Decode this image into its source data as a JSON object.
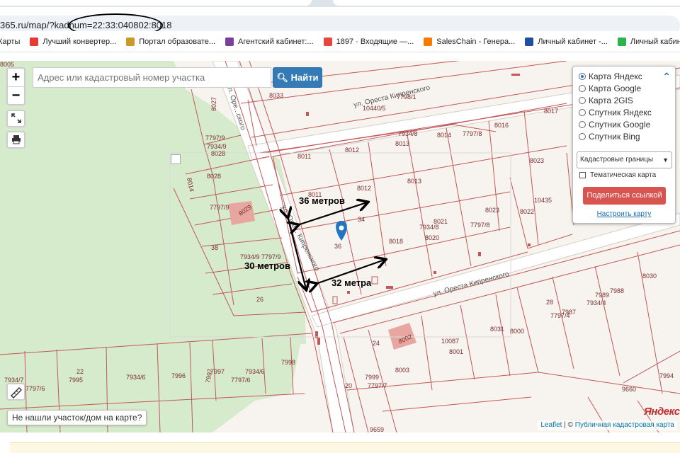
{
  "browser": {
    "url": "365.ru/map/?kadnum=22:33:040802:8018",
    "bookmarks": [
      {
        "label": "Карты",
        "icon": "maps-icon",
        "color": "#34a853"
      },
      {
        "label": "Лучший конвертер...",
        "icon": "converter-icon",
        "color": "#e53935"
      },
      {
        "label": "Портал образовате...",
        "icon": "coat-of-arms-icon",
        "color": "#c79a2a"
      },
      {
        "label": "Агентский кабинет:...",
        "icon": "agent-cabinet-icon",
        "color": "#7b3fa0"
      },
      {
        "label": "1897 · Входящие —...",
        "icon": "mail-icon",
        "color": "#e8453c"
      },
      {
        "label": "SalesChain - Генера...",
        "icon": "saleschain-icon",
        "color": "#f57c00"
      },
      {
        "label": "Личный кабинет -...",
        "icon": "cabinet-icon",
        "color": "#1e4fa3"
      },
      {
        "label": "Личный кабинет -...",
        "icon": "cabinet2-icon",
        "color": "#2bb24c"
      }
    ]
  },
  "map": {
    "search_placeholder": "Адрес или кадастровый номер участка",
    "search_button": "Найти",
    "zoom_in": "+",
    "zoom_out": "−",
    "layers": {
      "options": [
        {
          "label": "Карта Яндекс",
          "selected": true
        },
        {
          "label": "Карта Google",
          "selected": false
        },
        {
          "label": "Карта 2GIS",
          "selected": false
        },
        {
          "label": "Спутник Яндекс",
          "selected": false
        },
        {
          "label": "Спутник Google",
          "selected": false
        },
        {
          "label": "Спутник Bing",
          "selected": false
        }
      ],
      "select_value": "Кадастровые границы",
      "thematic_label": "Тематическая карта",
      "share_button": "Поделиться ссылкой",
      "setup_link": "Настроить карту"
    },
    "not_found_button": "Не нашли участок/дом на карте?",
    "attribution_leaflet": "Leaflet",
    "attribution_pkk": "Публичная кадастровая карта",
    "yandex_logo": "Яндекс",
    "streets": [
      "ул. Ореста Кипренского",
      "ул. Ореста Кипренского",
      "ул. Оре... Кипренского",
      "ул. Оре...ского"
    ],
    "annotations": [
      "36 метров",
      "30 метров",
      "32 метра"
    ],
    "parcel_labels": [
      "8033",
      "8027",
      "7797/9",
      "7934/9",
      "8028",
      "10440/5",
      "7798/1",
      "8017",
      "7934/8",
      "8013",
      "8014",
      "7797/8",
      "8016",
      "8011",
      "8012",
      "8023",
      "8028",
      "8011",
      "8012",
      "8013",
      "8014",
      "7797/9",
      "8029",
      "10435",
      "8023",
      "8022",
      "34",
      "7934/8",
      "8021",
      "7797/8",
      "36",
      "8018",
      "8020",
      "38",
      "7934/9 7797/9",
      "8030",
      "7989",
      "7988",
      "28",
      "7934/4",
      "7797/4",
      "7987",
      "26",
      "8031",
      "8000",
      "24",
      "8002",
      "10087",
      "8001",
      "22",
      "7995",
      "7934/6",
      "7996",
      "7997",
      "7997",
      "7934/6",
      "7797/6",
      "7998",
      "7999",
      "8003",
      "20",
      "7797/7",
      "7934/7",
      "7797/6",
      "7994",
      "9660",
      "9659",
      "8005"
    ]
  }
}
